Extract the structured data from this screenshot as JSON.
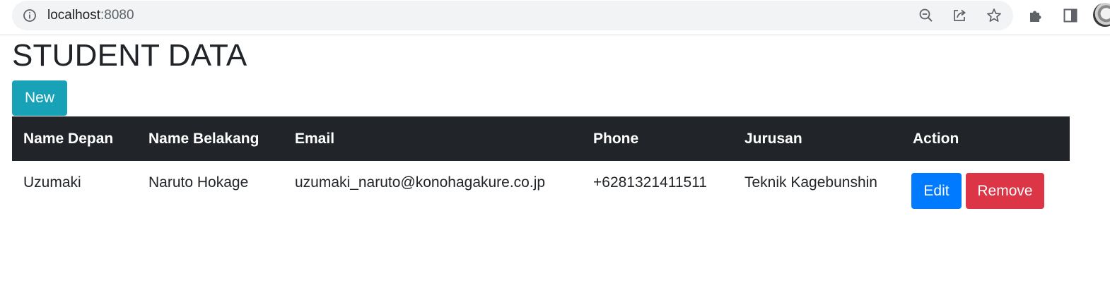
{
  "browser": {
    "url_host": "localhost",
    "url_port": ":8080"
  },
  "page": {
    "title": "STUDENT DATA",
    "new_label": "New"
  },
  "table": {
    "columns": [
      "Name Depan",
      "Name Belakang",
      "Email",
      "Phone",
      "Jurusan",
      "Action"
    ],
    "rows": [
      {
        "name_depan": "Uzumaki",
        "name_belakang": "Naruto Hokage",
        "email": "uzumaki_naruto@konohagakure.co.jp",
        "phone": "+6281321411511",
        "jurusan": "Teknik Kagebunshin",
        "edit_label": "Edit",
        "remove_label": "Remove"
      }
    ]
  },
  "icons": {
    "info": "info-icon",
    "zoom_out": "zoom-out-icon",
    "share": "share-icon",
    "bookmark": "star-icon",
    "extensions": "puzzle-icon",
    "side_panel": "side-panel-icon",
    "profile": "avatar"
  },
  "colors": {
    "header_bg": "#212529",
    "new_button": "#17a2b8",
    "edit_button": "#007bff",
    "remove_button": "#dc3545"
  }
}
